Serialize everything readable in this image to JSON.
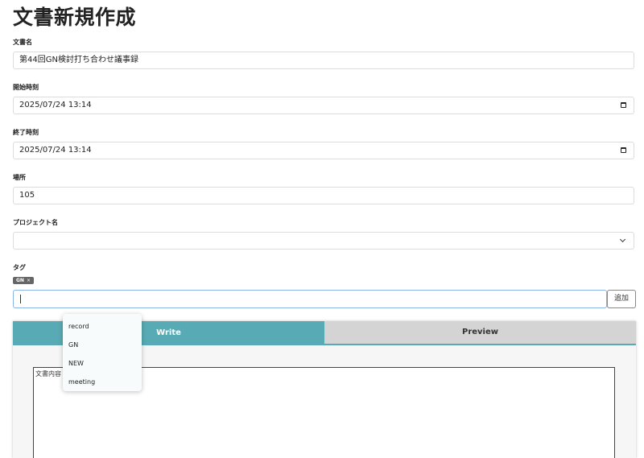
{
  "page": {
    "title": "文書新規作成"
  },
  "form": {
    "title_label": "文書名",
    "title_value": "第44回GN検討打ち合わせ議事録",
    "start_label": "開始時刻",
    "start_value": "2025/07/24 13:14",
    "end_label": "終了時刻",
    "end_value": "2025/07/24 13:14",
    "location_label": "場所",
    "location_value": "105",
    "project_label": "プロジェクト名",
    "project_value": "",
    "tags_label": "タグ"
  },
  "tags": {
    "selected": [
      "GN"
    ],
    "remove_symbol": "×",
    "input_value": "",
    "add_label": "追加",
    "suggestions": [
      "record",
      "GN",
      "NEW",
      "meeting"
    ]
  },
  "editor": {
    "tab_write": "Write",
    "tab_preview": "Preview",
    "active_tab": "Write",
    "placeholder": "文書内容",
    "active_color": "#58aab4"
  }
}
